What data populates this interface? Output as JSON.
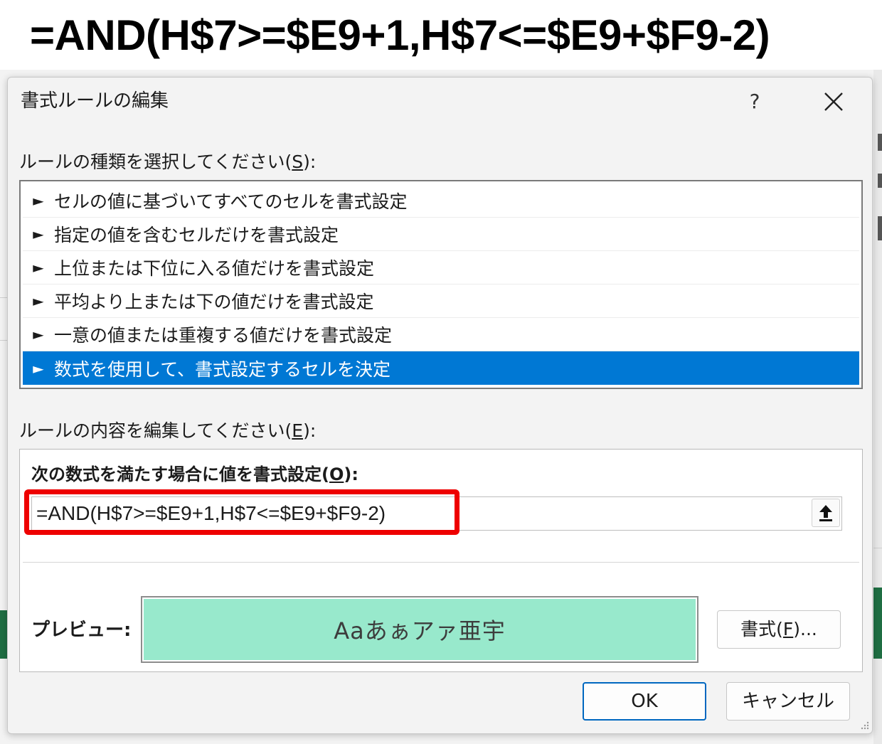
{
  "banner": {
    "formula": "=AND(H$7>=$E9+1,H$7<=$E9+$F9-2)"
  },
  "dialog": {
    "title": "書式ルールの編集",
    "help_label": "?",
    "rule_type_label_pre": "ルールの種類を選択してください(",
    "rule_type_label_key": "S",
    "rule_type_label_post": "):",
    "rule_types": [
      "セルの値に基づいてすべてのセルを書式設定",
      "指定の値を含むセルだけを書式設定",
      "上位または下位に入る値だけを書式設定",
      "平均より上または下の値だけを書式設定",
      "一意の値または重複する値だけを書式設定",
      "数式を使用して、書式設定するセルを決定"
    ],
    "selected_rule_index": 5,
    "rule_content_label_pre": "ルールの内容を編集してください(",
    "rule_content_label_key": "E",
    "rule_content_label_post": "):",
    "formula_label_pre": "次の数式を満たす場合に値を書式設定(",
    "formula_label_key": "O",
    "formula_label_post": "):",
    "formula_value": "=AND(H$7>=$E9+1,H$7<=$E9+$F9-2)",
    "preview_label": "プレビュー:",
    "preview_text": "Aaあぁアァ亜宇",
    "preview_fill_color": "#98e9cc",
    "format_button_pre": "書式(",
    "format_button_key": "F",
    "format_button_post": ")...",
    "ok_label": "OK",
    "cancel_label": "キャンセル",
    "highlight_color": "#ee0000",
    "selection_color": "#0078d4"
  },
  "icons": {
    "close": "close-icon",
    "collapse": "upload-arrow-icon",
    "arrow": "triangle-right-icon",
    "grip": "resize-grip-icon"
  }
}
